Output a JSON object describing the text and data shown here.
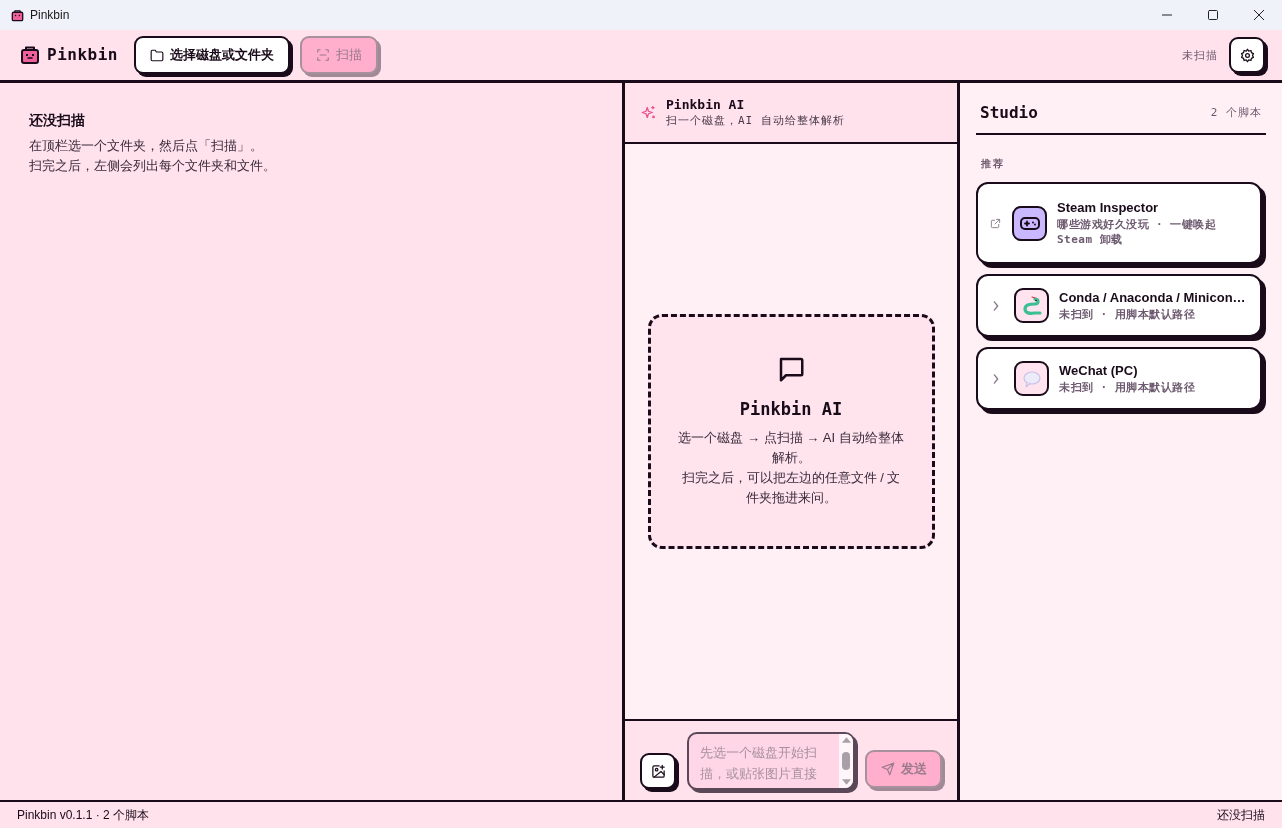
{
  "window": {
    "title": "Pinkbin"
  },
  "toolbar": {
    "brand": "Pinkbin",
    "pick_button": {
      "label": "选择磁盘或文件夹",
      "disabled": false
    },
    "scan_button": {
      "label": "扫描",
      "disabled": true
    },
    "scan_status": "未扫描"
  },
  "file_panel": {
    "title": "还没扫描",
    "lines": [
      "在顶栏选一个文件夹，然后点「扫描」。",
      "扫完之后，左侧会列出每个文件夹和文件。"
    ]
  },
  "ai_panel": {
    "title": "Pinkbin AI",
    "subtitle": "扫一个磁盘，AI 自动给整体解析",
    "empty_title": "Pinkbin AI",
    "empty_lines": [
      "选一个磁盘 → 点扫描 → AI 自动给整体解析。",
      "扫完之后，可以把左边的任意文件 / 文件夹拖进来问。"
    ],
    "input": {
      "placeholder": "先选一个磁盘开始扫描，或贴张图片直接"
    },
    "send_button": {
      "label": "发送",
      "disabled": true
    }
  },
  "studio": {
    "title": "Studio",
    "count": "2 个脚本",
    "section": "推荐",
    "scripts": [
      {
        "kind": "external",
        "name": "Steam Inspector",
        "description": "哪些游戏好久没玩 · 一键唤起 Steam 卸载",
        "color": "#c9b8ff"
      },
      {
        "kind": "expandable",
        "name": "Conda / Anaconda / Minicon…",
        "description": "未扫到 · 用脚本默认路径",
        "color": "#ffe3ee"
      },
      {
        "kind": "expandable",
        "name": "WeChat (PC)",
        "description": "未扫到 · 用脚本默认路径",
        "color": "#ffe3ee"
      }
    ]
  },
  "status_bar": {
    "left": "Pinkbin v0.1.1 · 2 个脚本",
    "right": "还没扫描"
  }
}
